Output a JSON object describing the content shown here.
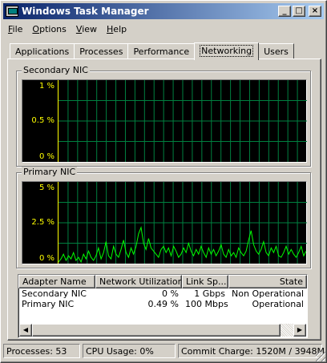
{
  "window": {
    "title": "Windows Task Manager",
    "controls": {
      "minimize": "_",
      "maximize": "□",
      "close": "×"
    }
  },
  "menu": [
    {
      "label": "File",
      "accel": "F",
      "rest": "ile"
    },
    {
      "label": "Options",
      "accel": "O",
      "rest": "ptions"
    },
    {
      "label": "View",
      "accel": "V",
      "rest": "iew"
    },
    {
      "label": "Help",
      "accel": "H",
      "rest": "elp"
    }
  ],
  "tabs": [
    "Applications",
    "Processes",
    "Performance",
    "Networking",
    "Users"
  ],
  "active_tab": "Networking",
  "graphs": {
    "secondary": {
      "label": "Secondary NIC",
      "ticks": [
        "1 %",
        "0.5 %",
        "0 %"
      ],
      "ymax": 1,
      "values": []
    },
    "primary": {
      "label": "Primary NIC",
      "ticks": [
        "5 %",
        "2.5 %",
        "0 %"
      ],
      "ymax": 5,
      "values": [
        0.0,
        0.2,
        0.5,
        0.1,
        0.4,
        0.2,
        0.6,
        0.1,
        0.3,
        0.0,
        0.5,
        0.2,
        0.7,
        0.3,
        0.1,
        0.4,
        0.9,
        0.2,
        0.6,
        1.3,
        0.4,
        0.2,
        1.0,
        0.5,
        0.3,
        0.8,
        1.4,
        0.6,
        0.3,
        0.9,
        0.5,
        1.0,
        1.8,
        2.2,
        1.2,
        0.8,
        1.5,
        0.9,
        0.7,
        0.5,
        0.3,
        0.8,
        1.0,
        0.6,
        0.9,
        0.4,
        1.0,
        0.7,
        0.3,
        0.5,
        0.9,
        0.6,
        1.2,
        0.7,
        0.4,
        0.8,
        0.5,
        1.0,
        0.6,
        0.3,
        0.9,
        0.5,
        0.8,
        0.4,
        0.7,
        1.1,
        0.5,
        0.3,
        0.8,
        0.4,
        0.6,
        0.3,
        0.9,
        0.6,
        0.4,
        0.7,
        1.4,
        2.0,
        1.1,
        0.7,
        0.5,
        0.8,
        1.3,
        0.6,
        0.4,
        0.9,
        0.6,
        1.0,
        0.4,
        0.3,
        0.6,
        1.0,
        0.5,
        0.8,
        0.5,
        0.3,
        0.6,
        1.0,
        0.4,
        0.7
      ]
    }
  },
  "adapters": {
    "columns": [
      "Adapter Name",
      "Network Utilization",
      "Link Sp...",
      "State"
    ],
    "rows": [
      {
        "name": "Secondary NIC",
        "utilization": "0 %",
        "speed": "1 Gbps",
        "state": "Non Operational"
      },
      {
        "name": "Primary NIC",
        "utilization": "0.49 %",
        "speed": "100 Mbps",
        "state": "Operational"
      }
    ]
  },
  "status": {
    "processes": "Processes: 53",
    "cpu": "CPU Usage: 0%",
    "commit": "Commit Charge: 1520M / 3948M"
  },
  "colors": {
    "grid": "#008040",
    "trace": "#00ff00",
    "axis": "#ffff00",
    "title_start": "#0a246a",
    "title_end": "#a6caf0"
  }
}
